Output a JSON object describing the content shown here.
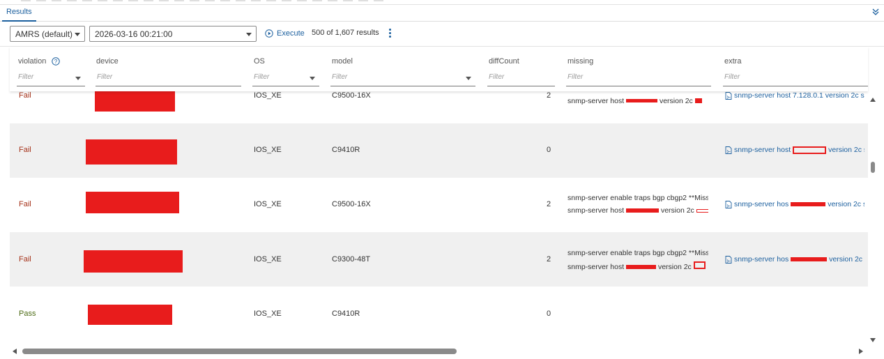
{
  "tabs": {
    "results_label": "Results"
  },
  "toolbar": {
    "profile_value": "AMRS (default)",
    "date_value": "2026-03-16 00:21:00",
    "execute_label": "Execute",
    "result_count": "500 of 1,607 results"
  },
  "columns": {
    "violation": "violation",
    "device": "device",
    "os": "OS",
    "model": "model",
    "diffcount": "diffCount",
    "missing": "missing",
    "extra": "extra",
    "filter_placeholder": "Filter"
  },
  "rows": [
    {
      "violation": "Fail",
      "os": "IOS_XE",
      "model": "C9500-16X",
      "diffcount": "2",
      "missing": [
        "snmp-server host",
        "version 2c"
      ],
      "extra": [
        "snmp-server host 7.128.0.1 version 2c s"
      ]
    },
    {
      "violation": "Fail",
      "os": "IOS_XE",
      "model": "C9410R",
      "diffcount": "0",
      "missing": [],
      "extra": [
        "snmp-server host",
        "version 2c s"
      ]
    },
    {
      "violation": "Fail",
      "os": "IOS_XE",
      "model": "C9500-16X",
      "diffcount": "2",
      "missing": [
        "snmp-server enable traps bgp cbgp2 **Miss",
        "snmp-server host",
        "version 2c"
      ],
      "extra": [
        "snmp-server hos",
        "version 2c s"
      ]
    },
    {
      "violation": "Fail",
      "os": "IOS_XE",
      "model": "C9300-48T",
      "diffcount": "2",
      "missing": [
        "snmp-server enable traps bgp cbgp2 **Miss",
        "snmp-server host",
        "version 2c"
      ],
      "extra": [
        "snmp-server hos",
        "version 2c s"
      ]
    },
    {
      "violation": "Pass",
      "os": "IOS_XE",
      "model": "C9410R",
      "diffcount": "0",
      "missing": [],
      "extra": []
    }
  ],
  "icons": {
    "collapse": "chevron-double-down-icon",
    "execute": "play-circle-icon",
    "more": "kebab-menu-icon",
    "help": "question-circle-icon",
    "extra_item": "document-icon"
  },
  "colors": {
    "accent": "#1b5f9e",
    "fail": "#a6331b",
    "pass": "#4c6b14",
    "redaction": "#e81c1c",
    "row_alt": "#f0f0f0"
  }
}
